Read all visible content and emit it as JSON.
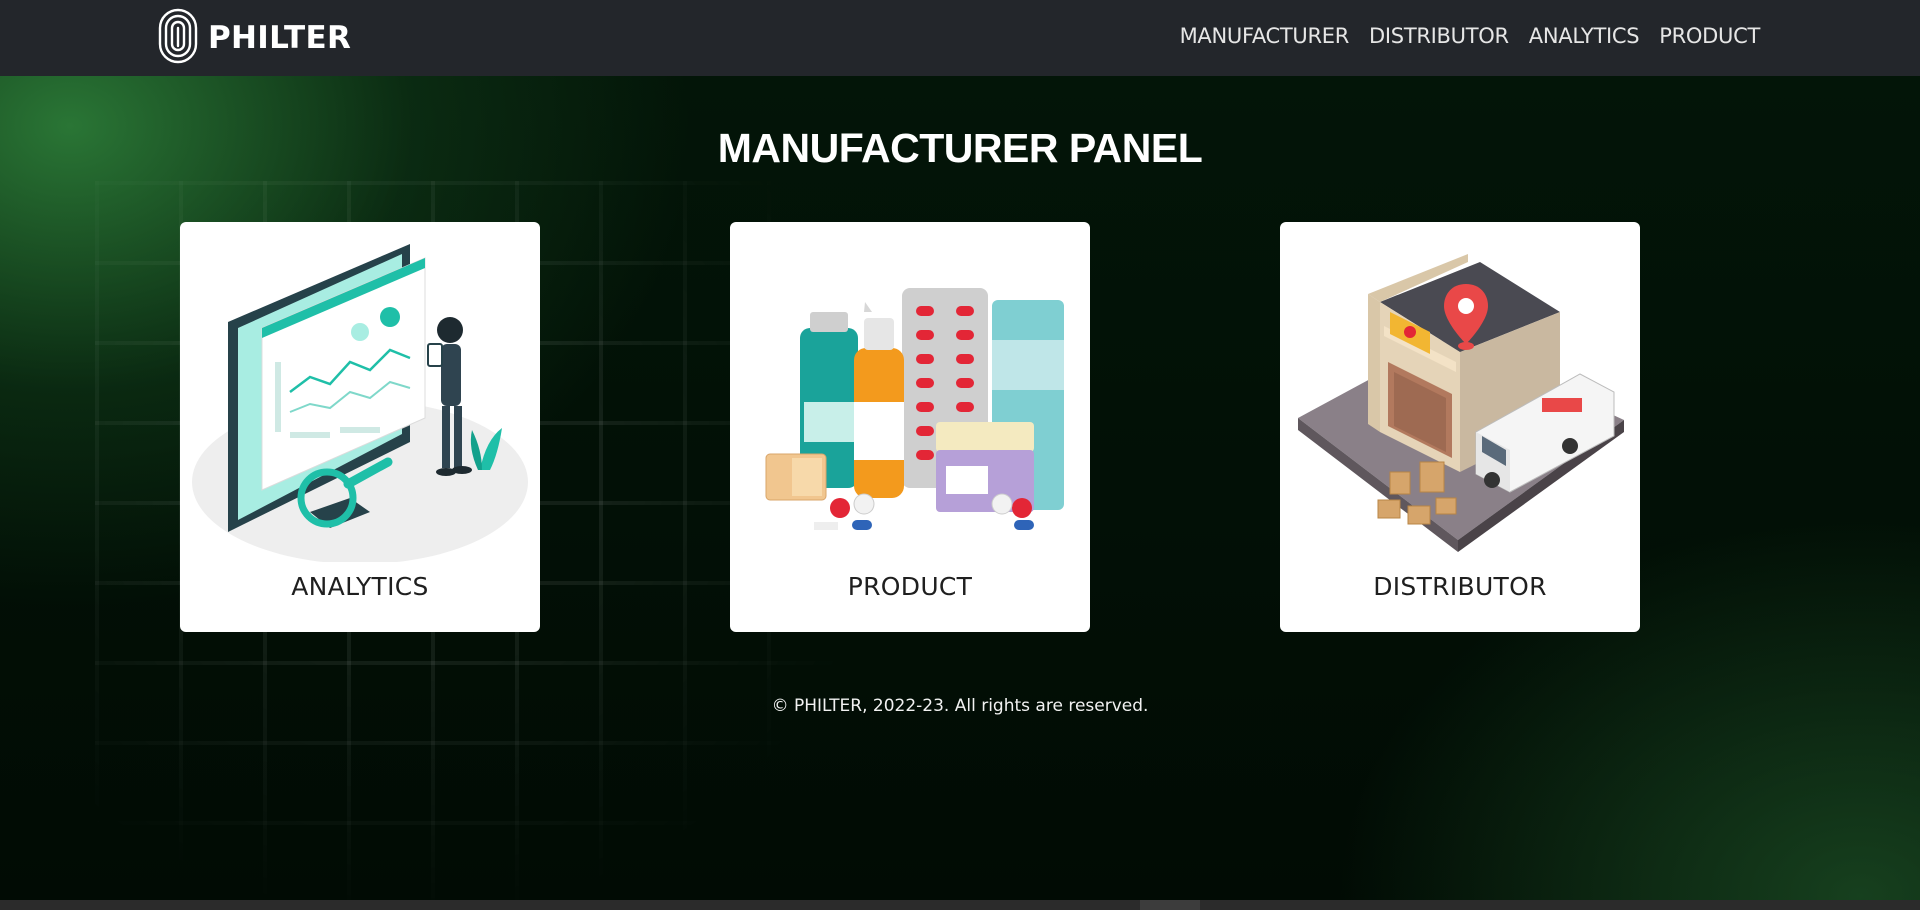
{
  "brand": {
    "name": "PHILTER",
    "logo_icon": "fingerprint-icon"
  },
  "nav": {
    "items": [
      {
        "label": "MANUFACTURER"
      },
      {
        "label": "DISTRIBUTOR"
      },
      {
        "label": "ANALYTICS"
      },
      {
        "label": "PRODUCT"
      }
    ]
  },
  "main": {
    "title": "MANUFACTURER PANEL",
    "cards": [
      {
        "label": "ANALYTICS",
        "illustration": "analytics-dashboard-illustration"
      },
      {
        "label": "PRODUCT",
        "illustration": "medicine-products-illustration"
      },
      {
        "label": "DISTRIBUTOR",
        "illustration": "delivery-warehouse-illustration"
      }
    ]
  },
  "footer": {
    "text": "© PHILTER, 2022-23. All rights are reserved."
  },
  "colors": {
    "navbar_bg": "#23262b",
    "hero_bg": "#020c05",
    "accent_green": "#2e803a",
    "teal": "#1fbfa8",
    "card_bg": "#ffffff"
  }
}
